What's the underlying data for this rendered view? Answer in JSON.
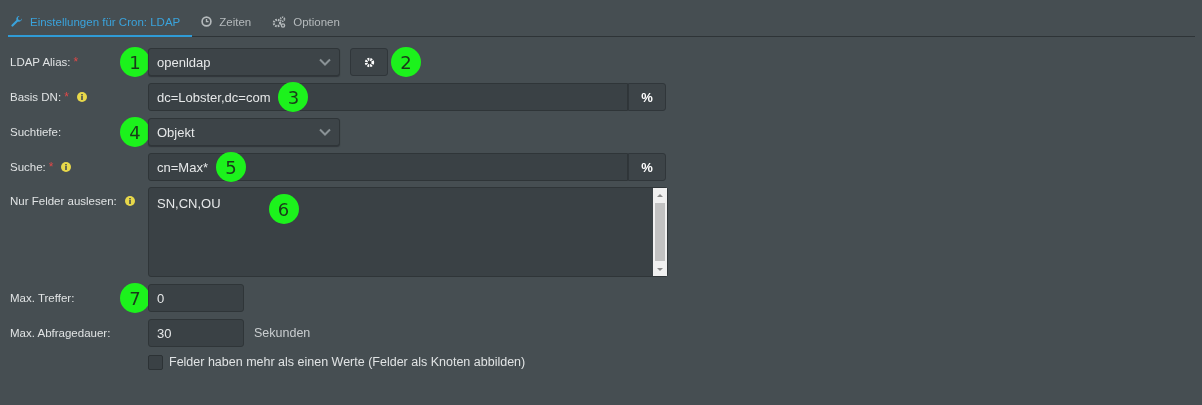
{
  "tabs": [
    {
      "label": "Einstellungen für Cron: LDAP",
      "selected": true
    },
    {
      "label": "Zeiten",
      "selected": false
    },
    {
      "label": "Optionen",
      "selected": false
    }
  ],
  "fields": [
    {
      "kind": "select",
      "label": "LDAP Alias:",
      "required_mark": "*",
      "info": false,
      "value": "openldap",
      "label_badge": "1",
      "action": {
        "badge": "2"
      }
    },
    {
      "kind": "input",
      "label": "Basis DN:",
      "required_mark": "*",
      "info": true,
      "value": "dc=Lobster,dc=com",
      "value_badge": "3",
      "button": "%"
    },
    {
      "kind": "select",
      "label": "Suchtiefe:",
      "info": false,
      "value": "Objekt",
      "label_badge": "4"
    },
    {
      "kind": "input",
      "label": "Suche:",
      "required_mark": "*",
      "info": true,
      "value": "cn=Max*",
      "value_badge": "5",
      "button": "%"
    },
    {
      "kind": "textarea",
      "label": "Nur Felder auslesen:",
      "info": true,
      "value": "SN,CN,OU",
      "value_badge": "6"
    },
    {
      "kind": "number",
      "label": "Max. Treffer:",
      "info": false,
      "value": "0",
      "label_badge": "7"
    },
    {
      "kind": "number",
      "label": "Max. Abfragedauer:",
      "info": false,
      "value": "30",
      "suffix": "Sekunden"
    },
    {
      "kind": "checkbox",
      "label": "Felder haben mehr als einen Werte (Felder als Knoten abbilden)",
      "checked": false
    }
  ]
}
